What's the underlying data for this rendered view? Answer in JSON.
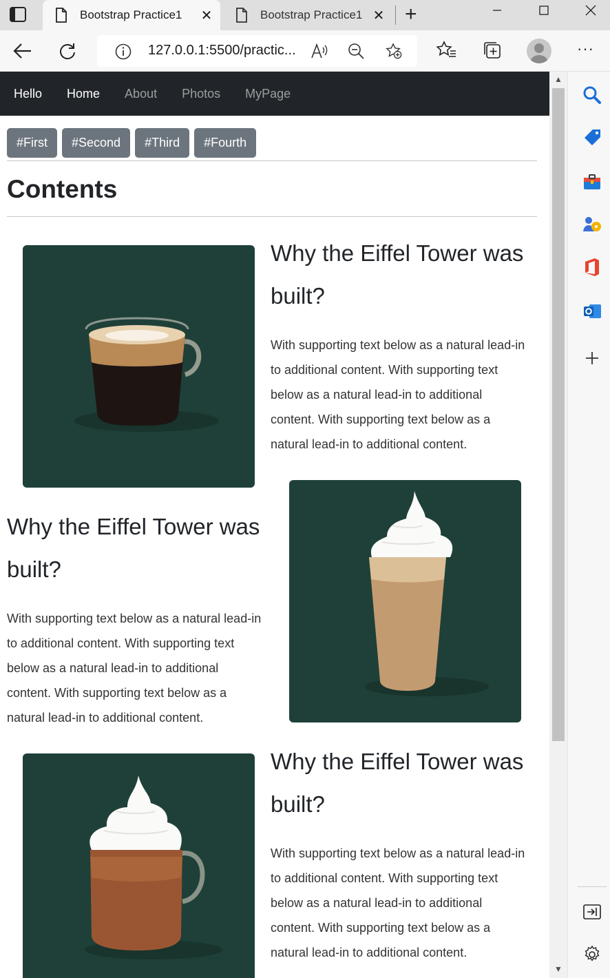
{
  "browser": {
    "tabs": [
      {
        "title": "Bootstrap Practice1",
        "active": true
      },
      {
        "title": "Bootstrap Practice1",
        "active": false
      }
    ],
    "url": "127.0.0.1:5500/practic..."
  },
  "navbar": {
    "brand": "Hello",
    "links": [
      {
        "label": "Home",
        "active": true
      },
      {
        "label": "About",
        "active": false
      },
      {
        "label": "Photos",
        "active": false
      },
      {
        "label": "MyPage",
        "active": false
      }
    ]
  },
  "anchors": [
    "#First",
    "#Second",
    "#Third",
    "#Fourth"
  ],
  "section_title": "Contents",
  "cards": [
    {
      "title": "Why the Eiffel Tower was built?",
      "text": "With supporting text below as a natural lead-in to additional content. With supporting text below as a natural lead-in to additional content. With supporting text below as a natural lead-in to additional content.",
      "image": "hot-coffee-glass-cup",
      "image_position": "left"
    },
    {
      "title": "Why the Eiffel Tower was built?",
      "text": "With supporting text below as a natural lead-in to additional content. With supporting text below as a natural lead-in to additional content. With supporting text below as a natural lead-in to additional content.",
      "image": "iced-frappuccino-whipped-cream",
      "image_position": "right"
    },
    {
      "title": "Why the Eiffel Tower was built?",
      "text": "With supporting text below as a natural lead-in to additional content. With supporting text below as a natural lead-in to additional content. With supporting text below as a natural lead-in to additional content.",
      "image": "hot-chocolate-mug-whipped-cream",
      "image_position": "left"
    }
  ],
  "colors": {
    "navbar_bg": "#212529",
    "button_bg": "#6c757d",
    "image_bg": "#1e4039"
  }
}
